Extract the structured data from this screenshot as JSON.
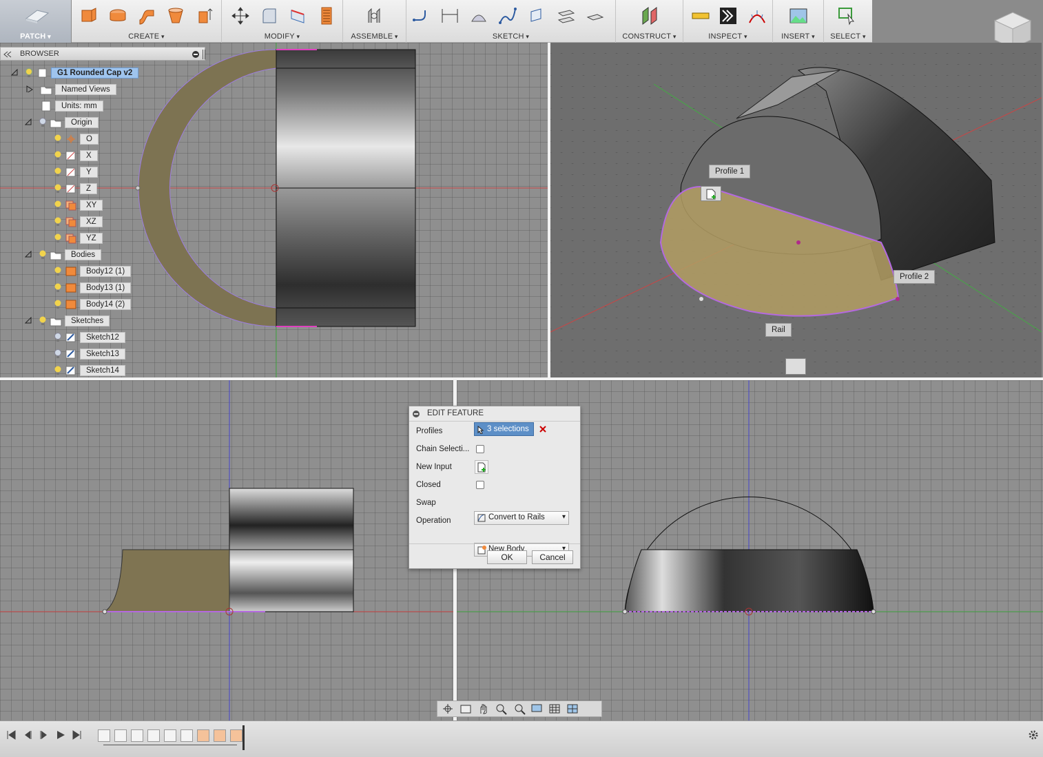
{
  "toolbar": {
    "patch": "PATCH",
    "groups": [
      "CREATE",
      "MODIFY",
      "ASSEMBLE",
      "SKETCH",
      "CONSTRUCT",
      "INSPECT",
      "INSERT",
      "SELECT"
    ]
  },
  "browser": {
    "title": "BROWSER",
    "items": [
      {
        "label": "G1 Rounded Cap v2"
      },
      {
        "label": "Named Views"
      },
      {
        "label": "Units: mm"
      },
      {
        "label": "Origin"
      },
      {
        "label": "O"
      },
      {
        "label": "X"
      },
      {
        "label": "Y"
      },
      {
        "label": "Z"
      },
      {
        "label": "XY"
      },
      {
        "label": "XZ"
      },
      {
        "label": "YZ"
      },
      {
        "label": "Bodies"
      },
      {
        "label": "Body12 (1)"
      },
      {
        "label": "Body13 (1)"
      },
      {
        "label": "Body14 (2)"
      },
      {
        "label": "Sketches"
      },
      {
        "label": "Sketch12"
      },
      {
        "label": "Sketch13"
      },
      {
        "label": "Sketch14"
      }
    ]
  },
  "canvas": {
    "profile1": "Profile 1",
    "profile2": "Profile 2",
    "rail": "Rail"
  },
  "dialog": {
    "title": "EDIT FEATURE",
    "profiles_label": "Profiles",
    "profiles_value": "3 selections",
    "chain_label": "Chain Selecti...",
    "new_input_label": "New Input",
    "closed_label": "Closed",
    "swap_label": "Swap",
    "swap_value": "Convert to Rails",
    "operation_label": "Operation",
    "operation_value": "New Body",
    "ok": "OK",
    "cancel": "Cancel"
  },
  "colors": {
    "accent": "#5d8fc7",
    "surface_tan": "#8a7d52",
    "highlight": "#b469e0"
  }
}
